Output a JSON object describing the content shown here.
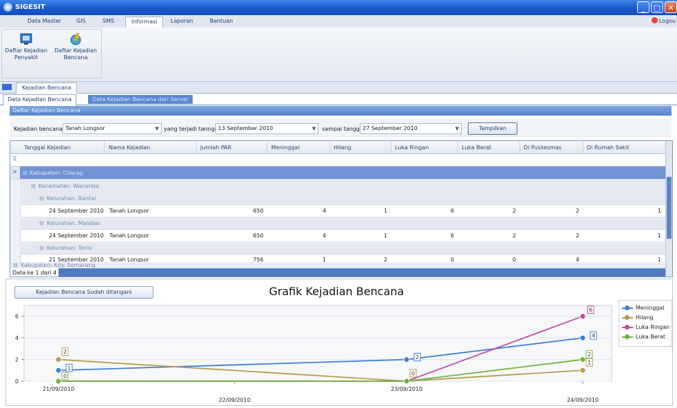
{
  "window": {
    "title": "SIGESIT",
    "min": "_",
    "max": "□",
    "close": "✕"
  },
  "menu": {
    "tabs": [
      "Data Master",
      "GIS",
      "SMS",
      "Informasi",
      "Laporan",
      "Bantuan"
    ],
    "logout": "Logou"
  },
  "ribbon": {
    "btn_penyakit": [
      "Daftar Kejadian",
      "Penyakit"
    ],
    "btn_bencana": [
      "Daftar Kejadian",
      "Bencana"
    ]
  },
  "doc_tab": "Kejadian Bencana",
  "sub_tabs": {
    "active": "Data Kejadian Bencana",
    "server": "Data Kejadian Bencana dari Server"
  },
  "section_title": "Daftar Kejadian Bencana",
  "filter": {
    "label_kejadian": "Kejadian bencana",
    "kejadian_value": "Tanah Longsor",
    "label_terjadi": "yang terjadi tanngal",
    "from_date": "13 September 2010",
    "label_sampai": "sampai tanggal",
    "to_date": "27 September 2010",
    "button": "Tampilkan"
  },
  "grid": {
    "columns": [
      "Tanggal Kejadian",
      "Nama Kejadian",
      "Jumlah PAR",
      "Meninggal",
      "Hilang",
      "Luka Ringan",
      "Luka Berat",
      "Di Puskesmas",
      "Di Rumah Sakit"
    ],
    "group_kabupaten_1": "Kabupaten: Cilacap",
    "group_kecamatan": "Kecamatan: Wanareja",
    "groups": [
      {
        "kelurahan": "Kelurahan: Bantar",
        "row": [
          "24 September 2010",
          "Tanah Longsor",
          "650",
          "4",
          "1",
          "6",
          "2",
          "2",
          "1"
        ]
      },
      {
        "kelurahan": "Kelurahan: Malabar",
        "row": [
          "24 September 2010",
          "Tanah Longsor",
          "650",
          "4",
          "1",
          "6",
          "2",
          "2",
          "1"
        ]
      },
      {
        "kelurahan": "Kelurahan: Torisi",
        "row": [
          "21 September 2010",
          "Tanah Longsor",
          "756",
          "1",
          "2",
          "0",
          "0",
          "4",
          "1"
        ]
      }
    ],
    "group_kabupaten_2": "Kabupaten: Kdy. Semarang",
    "pager": "Data ke 1 dari 4"
  },
  "chart_button": "Kejadian Bencana Sudah ditangani",
  "chart_data": {
    "type": "line",
    "title": "Grafik Kejadian Bencana",
    "x": [
      "21/09/2010",
      "23/09/2010",
      "24/09/2010"
    ],
    "x_ticks": [
      "21/09/2010",
      "22/09/2010",
      "23/09/2010",
      "24/09/2010"
    ],
    "ylim": [
      0,
      7
    ],
    "y_ticks": [
      "0",
      "2",
      "4",
      "6"
    ],
    "grid": true,
    "legend": "right",
    "series": [
      {
        "name": "Meninggal",
        "color": "#3d7fd6",
        "values": [
          1,
          2,
          4
        ]
      },
      {
        "name": "Hilang",
        "color": "#b89a4a",
        "values": [
          2,
          0,
          1
        ]
      },
      {
        "name": "Luka Ringan",
        "color": "#c04a9e",
        "values": [
          0,
          0,
          6
        ]
      },
      {
        "name": "Luka Berat",
        "color": "#6cb23e",
        "values": [
          0,
          0,
          2
        ]
      }
    ],
    "labels_shown": {
      "Meninggal": [
        1,
        2,
        4
      ],
      "Hilang": [
        2,
        0,
        1
      ],
      "Luka Ringan": [
        null,
        null,
        6
      ],
      "Luka Berat": [
        0,
        null,
        2
      ]
    }
  }
}
